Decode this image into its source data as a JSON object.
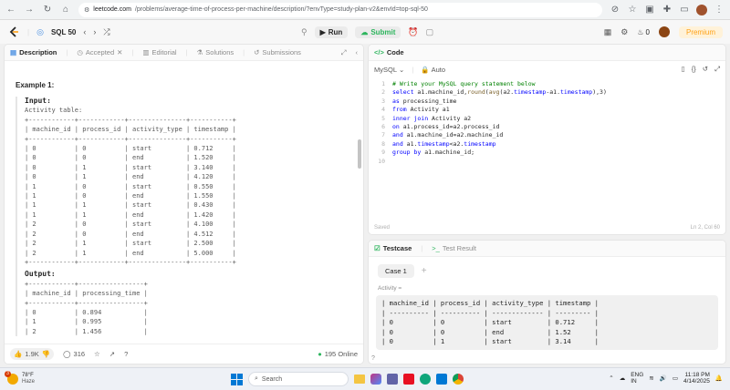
{
  "browser": {
    "url_domain": "leetcode.com",
    "url_path": "/problems/average-time-of-process-per-machine/description/?envType=study-plan-v2&envId=top-sql-50"
  },
  "header": {
    "study_plan": "SQL 50",
    "run_label": "Run",
    "submit_label": "Submit",
    "streak": "0",
    "premium_label": "Premium"
  },
  "left_tabs": [
    {
      "label": "Description"
    },
    {
      "label": "Accepted"
    },
    {
      "label": "Editorial"
    },
    {
      "label": "Solutions"
    },
    {
      "label": "Submissions"
    }
  ],
  "description": {
    "example_title": "Example 1:",
    "input_label": "Input:",
    "activity_label": "Activity table:",
    "input_table": "+------------+------------+---------------+-----------+\n| machine_id | process_id | activity_type | timestamp |\n+------------+------------+---------------+-----------+\n| 0          | 0          | start         | 0.712     |\n| 0          | 0          | end           | 1.520     |\n| 0          | 1          | start         | 3.140     |\n| 0          | 1          | end           | 4.120     |\n| 1          | 0          | start         | 0.550     |\n| 1          | 0          | end           | 1.550     |\n| 1          | 1          | start         | 0.430     |\n| 1          | 1          | end           | 1.420     |\n| 2          | 0          | start         | 4.100     |\n| 2          | 0          | end           | 4.512     |\n| 2          | 1          | start         | 2.500     |\n| 2          | 1          | end           | 5.000     |\n+------------+------------+---------------+-----------+",
    "output_label": "Output:",
    "output_table": "+------------+-----------------+\n| machine_id | processing_time |\n+------------+-----------------+\n| 0          | 0.894           |\n| 1          | 0.995           |\n| 2          | 1.456           |"
  },
  "footer": {
    "likes": "1.9K",
    "comments": "316",
    "online": "195 Online"
  },
  "code_panel": {
    "title": "Code",
    "language": "MySQL",
    "auto_label": "Auto",
    "saved_label": "Saved",
    "cursor_pos": "Ln 2, Col 60"
  },
  "code_lines": [
    [
      {
        "t": "# Write your MySQL query statement below",
        "c": "cm"
      }
    ],
    [
      {
        "t": "select ",
        "c": "kw"
      },
      {
        "t": "a1.machine_id,",
        "c": "tk"
      },
      {
        "t": "round",
        "c": "fn"
      },
      {
        "t": "(",
        "c": "tk"
      },
      {
        "t": "avg",
        "c": "fn"
      },
      {
        "t": "(a2.",
        "c": "tk"
      },
      {
        "t": "timestamp",
        "c": "kw"
      },
      {
        "t": "-a1.",
        "c": "tk"
      },
      {
        "t": "timestamp",
        "c": "kw"
      },
      {
        "t": "),3)",
        "c": "tk"
      }
    ],
    [
      {
        "t": "as ",
        "c": "kw"
      },
      {
        "t": "processing_time",
        "c": "tk"
      }
    ],
    [
      {
        "t": "from ",
        "c": "kw"
      },
      {
        "t": "Activity a1",
        "c": "tk"
      }
    ],
    [
      {
        "t": "inner join ",
        "c": "kw"
      },
      {
        "t": "Activity a2",
        "c": "tk"
      }
    ],
    [
      {
        "t": "on ",
        "c": "kw"
      },
      {
        "t": "a1.process_id=a2.process_id",
        "c": "tk"
      }
    ],
    [
      {
        "t": "and ",
        "c": "kw"
      },
      {
        "t": "a1.machine_id=a2.machine_id",
        "c": "tk"
      }
    ],
    [
      {
        "t": "and ",
        "c": "kw"
      },
      {
        "t": "a1.",
        "c": "tk"
      },
      {
        "t": "timestamp",
        "c": "kw"
      },
      {
        "t": "<a2.",
        "c": "tk"
      },
      {
        "t": "timestamp",
        "c": "kw"
      }
    ],
    [
      {
        "t": "group by ",
        "c": "kw"
      },
      {
        "t": "a1.machine_id;",
        "c": "tk"
      }
    ],
    []
  ],
  "testcase": {
    "tab_label": "Testcase",
    "result_label": "Test Result",
    "case_label": "Case 1",
    "activity_label": "Activity =",
    "table": "| machine_id | process_id | activity_type | timestamp |\n| ---------- | ---------- | ------------- | --------- |\n| 0          | 0          | start         | 0.712     |\n| 0          | 0          | end           | 1.52      |\n| 0          | 1          | start         | 3.14      |"
  },
  "taskbar": {
    "weather_temp": "78°F",
    "weather_desc": "Haze",
    "search_placeholder": "Search",
    "lang": "ENG",
    "region": "IN",
    "time": "11:18 PM",
    "date": "4/14/2025",
    "badge": "3"
  }
}
